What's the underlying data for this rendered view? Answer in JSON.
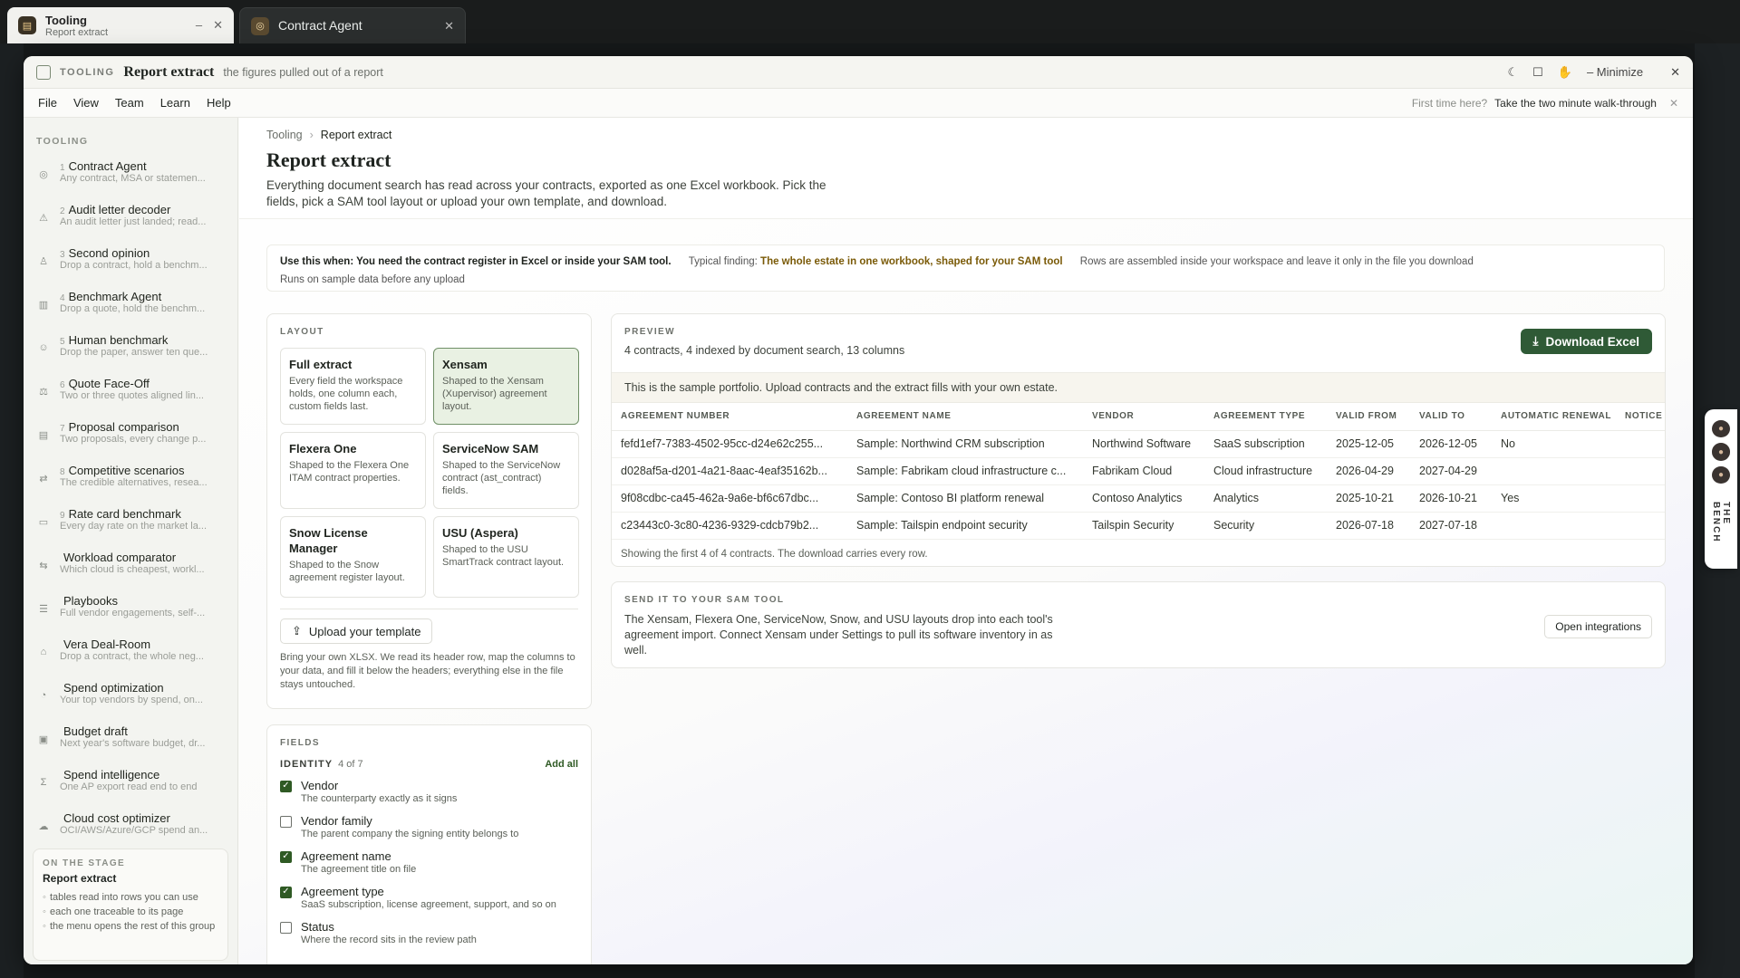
{
  "browser_tabs": [
    {
      "title": "Tooling",
      "subtitle": "Report extract",
      "min": "–",
      "close": "✕"
    },
    {
      "title": "Contract Agent",
      "close": "✕"
    }
  ],
  "window": {
    "tag": "TOOLING",
    "title": "Report extract",
    "subtitle": "the figures pulled out of a report",
    "minimize_label": "Minimize"
  },
  "menu": {
    "items": [
      "File",
      "View",
      "Team",
      "Learn",
      "Help"
    ],
    "tour_question": "First time here?",
    "tour_action": "Take the two minute walk-through"
  },
  "sidebar": {
    "caption": "TOOLING",
    "items": [
      {
        "num": "1",
        "label": "Contract Agent",
        "desc": "Any contract, MSA or statemen...",
        "icon": "scan-icon"
      },
      {
        "num": "2",
        "label": "Audit letter decoder",
        "desc": "An audit letter just landed; read...",
        "icon": "alert-icon"
      },
      {
        "num": "3",
        "label": "Second opinion",
        "desc": "Drop a contract, hold a benchm...",
        "icon": "person-icon"
      },
      {
        "num": "4",
        "label": "Benchmark Agent",
        "desc": "Drop a quote, hold the benchm...",
        "icon": "bar-chart-icon"
      },
      {
        "num": "5",
        "label": "Human benchmark",
        "desc": "Drop the paper, answer ten que...",
        "icon": "user-check-icon"
      },
      {
        "num": "6",
        "label": "Quote Face-Off",
        "desc": "Two or three quotes aligned lin...",
        "icon": "versus-icon"
      },
      {
        "num": "7",
        "label": "Proposal comparison",
        "desc": "Two proposals, every change p...",
        "icon": "document-icon"
      },
      {
        "num": "8",
        "label": "Competitive scenarios",
        "desc": "The credible alternatives, resea...",
        "icon": "shuffle-icon"
      },
      {
        "num": "9",
        "label": "Rate card benchmark",
        "desc": "Every day rate on the market la...",
        "icon": "card-icon"
      },
      {
        "num": "",
        "label": "Workload comparator",
        "desc": "Which cloud is cheapest, workl...",
        "icon": "compare-icon"
      },
      {
        "num": "",
        "label": "Playbooks",
        "desc": "Full vendor engagements, self-...",
        "icon": "list-icon"
      },
      {
        "num": "",
        "label": "Vera Deal-Room",
        "desc": "Drop a contract, the whole neg...",
        "icon": "building-icon"
      },
      {
        "num": "",
        "label": "Spend optimization",
        "desc": "Your top vendors by spend, on...",
        "icon": "piggy-icon"
      },
      {
        "num": "",
        "label": "Budget draft",
        "desc": "Next year's software budget, dr...",
        "icon": "wallet-icon"
      },
      {
        "num": "",
        "label": "Spend intelligence",
        "desc": "One AP export read end to end",
        "icon": "sigma-icon"
      },
      {
        "num": "",
        "label": "Cloud cost optimizer",
        "desc": "OCI/AWS/Azure/GCP spend an...",
        "icon": "cloud-icon"
      }
    ],
    "stage": {
      "caption": "ON THE STAGE",
      "title": "Report extract",
      "bullets": [
        "tables read into rows you can use",
        "each one traceable to its page",
        "the menu opens the rest of this group"
      ]
    }
  },
  "breadcrumb": {
    "parent": "Tooling",
    "separator": "›",
    "current": "Report extract"
  },
  "page": {
    "title": "Report extract",
    "description": "Everything document search has read across your contracts, exported as one Excel workbook. Pick the fields, pick a SAM tool layout or upload your own template, and download."
  },
  "banner": {
    "use_when": "Use this when: You need the contract register in Excel or inside your SAM tool.",
    "finding_label": "Typical finding:",
    "finding_value": "The whole estate in one workbook, shaped for your SAM tool",
    "privacy": "Rows are assembled inside your workspace and leave it only in the file you download",
    "sample_note": "Runs on sample data before any upload"
  },
  "layout": {
    "caption": "LAYOUT",
    "options": [
      {
        "name": "Full extract",
        "desc": "Every field the workspace holds, one column each, custom fields last.",
        "selected": false
      },
      {
        "name": "Xensam",
        "desc": "Shaped to the Xensam (Xupervisor) agreement layout.",
        "selected": true
      },
      {
        "name": "Flexera One",
        "desc": "Shaped to the Flexera One ITAM contract properties.",
        "selected": false
      },
      {
        "name": "ServiceNow SAM",
        "desc": "Shaped to the ServiceNow contract (ast_contract) fields.",
        "selected": false
      },
      {
        "name": "Snow License Manager",
        "desc": "Shaped to the Snow agreement register layout.",
        "selected": false
      },
      {
        "name": "USU (Aspera)",
        "desc": "Shaped to the USU SmartTrack contract layout.",
        "selected": false
      }
    ],
    "upload_label": "Upload your template",
    "upload_help": "Bring your own XLSX. We read its header row, map the columns to your data, and fill it below the headers; everything else in the file stays untouched."
  },
  "fields": {
    "caption": "FIELDS",
    "group": "IDENTITY",
    "count": "4 of 7",
    "add_all": "Add all",
    "items": [
      {
        "name": "Vendor",
        "desc": "The counterparty exactly as it signs",
        "checked": true
      },
      {
        "name": "Vendor family",
        "desc": "The parent company the signing entity belongs to",
        "checked": false
      },
      {
        "name": "Agreement name",
        "desc": "The agreement title on file",
        "checked": true
      },
      {
        "name": "Agreement type",
        "desc": "SaaS subscription, license agreement, support, and so on",
        "checked": true
      },
      {
        "name": "Status",
        "desc": "Where the record sits in the review path",
        "checked": false
      }
    ]
  },
  "preview": {
    "caption": "PREVIEW",
    "summary": "4 contracts, 4 indexed by document search, 13 columns",
    "download_label": "Download Excel",
    "notice": "This is the sample portfolio. Upload contracts and the extract fills with your own estate.",
    "columns": [
      "AGREEMENT NUMBER",
      "AGREEMENT NAME",
      "VENDOR",
      "AGREEMENT TYPE",
      "VALID FROM",
      "VALID TO",
      "AUTOMATIC RENEWAL",
      "NOTICE P"
    ],
    "rows": [
      [
        "fefd1ef7-7383-4502-95cc-d24e62c255...",
        "Sample: Northwind CRM subscription",
        "Northwind Software",
        "SaaS subscription",
        "2025-12-05",
        "2026-12-05",
        "No",
        ""
      ],
      [
        "d028af5a-d201-4a21-8aac-4eaf35162b...",
        "Sample: Fabrikam cloud infrastructure c...",
        "Fabrikam Cloud",
        "Cloud infrastructure",
        "2026-04-29",
        "2027-04-29",
        "",
        ""
      ],
      [
        "9f08cdbc-ca45-462a-9a6e-bf6c67dbc...",
        "Sample: Contoso BI platform renewal",
        "Contoso Analytics",
        "Analytics",
        "2025-10-21",
        "2026-10-21",
        "Yes",
        ""
      ],
      [
        "c23443c0-3c80-4236-9329-cdcb79b2...",
        "Sample: Tailspin endpoint security",
        "Tailspin Security",
        "Security",
        "2026-07-18",
        "2027-07-18",
        "",
        ""
      ]
    ],
    "footer": "Showing the first 4 of 4 contracts. The download carries every row."
  },
  "sam_tool": {
    "caption": "SEND IT TO YOUR SAM TOOL",
    "text": "The Xensam, Flexera One, ServiceNow, Snow, and USU layouts drop into each tool's agreement import. Connect Xensam under Settings to pull its software inventory in as well.",
    "button": "Open integrations"
  },
  "bench": {
    "label": "THE BENCH"
  },
  "colors": {
    "accent": "#2f5a36",
    "selected_card": "#e9f1e3",
    "gold": "#7a5a07"
  }
}
